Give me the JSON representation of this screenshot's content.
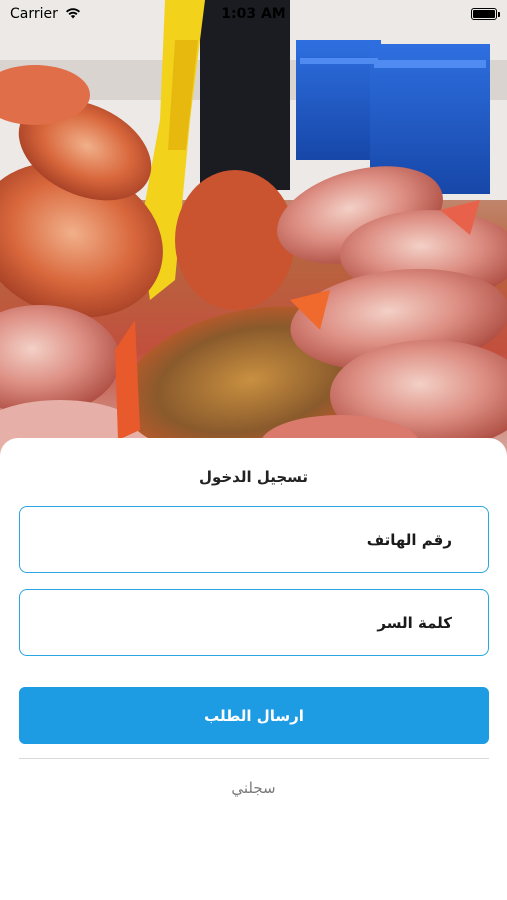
{
  "status_bar": {
    "carrier": "Carrier",
    "time": "1:03 AM",
    "wifi_icon": "wifi-icon",
    "battery_icon": "battery-icon"
  },
  "hero": {
    "image": "fish-market-photo"
  },
  "login": {
    "title": "تسجيل الدخول",
    "phone_placeholder": "رقم الهاتف",
    "password_placeholder": "كلمة السر",
    "submit_label": "ارسال الطلب",
    "register_label": "سجلني"
  },
  "colors": {
    "accent": "#1e9ce3",
    "field_border": "#2aa6e3",
    "register_text": "#7b7b7b"
  }
}
